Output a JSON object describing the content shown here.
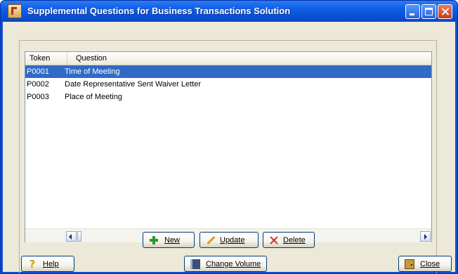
{
  "window": {
    "title": "Supplemental Questions for Business Transactions Solution"
  },
  "list": {
    "columns": [
      "Token",
      "Question"
    ],
    "rows": [
      {
        "token": "P0001",
        "question": "Time of Meeting",
        "selected": true
      },
      {
        "token": "P0002",
        "question": "Date Representative Sent Waiver Letter",
        "selected": false
      },
      {
        "token": "P0003",
        "question": "Place of Meeting",
        "selected": false
      }
    ]
  },
  "actions": {
    "new_label": "New",
    "update_label": "Update",
    "delete_label": "Delete"
  },
  "footer": {
    "help_label": "Help",
    "change_volume_label": "Change Volume",
    "close_label": "Close"
  },
  "icons": {
    "new": "plus-icon",
    "update": "pencil-icon",
    "delete": "x-icon",
    "help": "question-icon",
    "change_volume": "book-icon",
    "close": "door-icon"
  },
  "colors": {
    "titlebar": "#0a52d6",
    "selection": "#316ac5",
    "dialog_bg": "#ece9d8"
  }
}
